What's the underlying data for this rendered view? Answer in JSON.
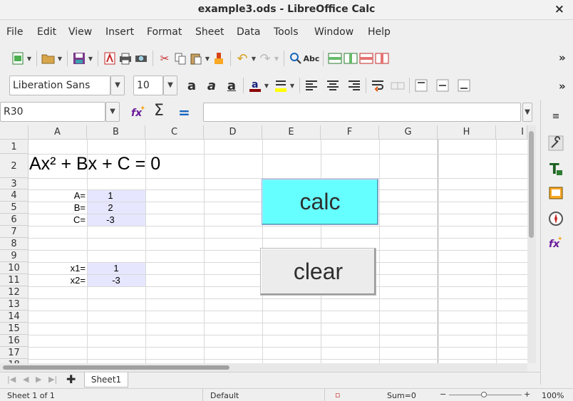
{
  "window": {
    "title": "example3.ods - LibreOffice Calc",
    "close": "×"
  },
  "menu": [
    "File",
    "Edit",
    "View",
    "Insert",
    "Format",
    "Sheet",
    "Data",
    "Tools",
    "Window",
    "Help"
  ],
  "formatting": {
    "font_name": "Liberation Sans",
    "font_size": "10"
  },
  "formula_bar": {
    "name_box": "R30",
    "formula": ""
  },
  "columns": [
    "A",
    "B",
    "C",
    "D",
    "E",
    "F",
    "G",
    "H",
    "I"
  ],
  "rows": [
    "1",
    "2",
    "3",
    "4",
    "5",
    "6",
    "7",
    "8",
    "9",
    "10",
    "11",
    "12",
    "13",
    "14",
    "15",
    "16",
    "17",
    "18"
  ],
  "cells": {
    "a2": "Ax² + Bx + C = 0",
    "a4": "A=",
    "b4": "1",
    "a5": "B=",
    "b5": "2",
    "a6": "C=",
    "b6": "-3",
    "a10": "x1=",
    "b10": "1",
    "a11": "x2=",
    "b11": "-3"
  },
  "buttons": {
    "calc": "calc",
    "clear": "clear"
  },
  "sheet_tabs": [
    "Sheet1"
  ],
  "statusbar": {
    "sheet": "Sheet 1 of 1",
    "style": "Default",
    "sum": "Sum=0",
    "zoom": "100%"
  },
  "colors": {
    "calc_button": "#66ffff",
    "input_shade": "#e6e6ff"
  }
}
